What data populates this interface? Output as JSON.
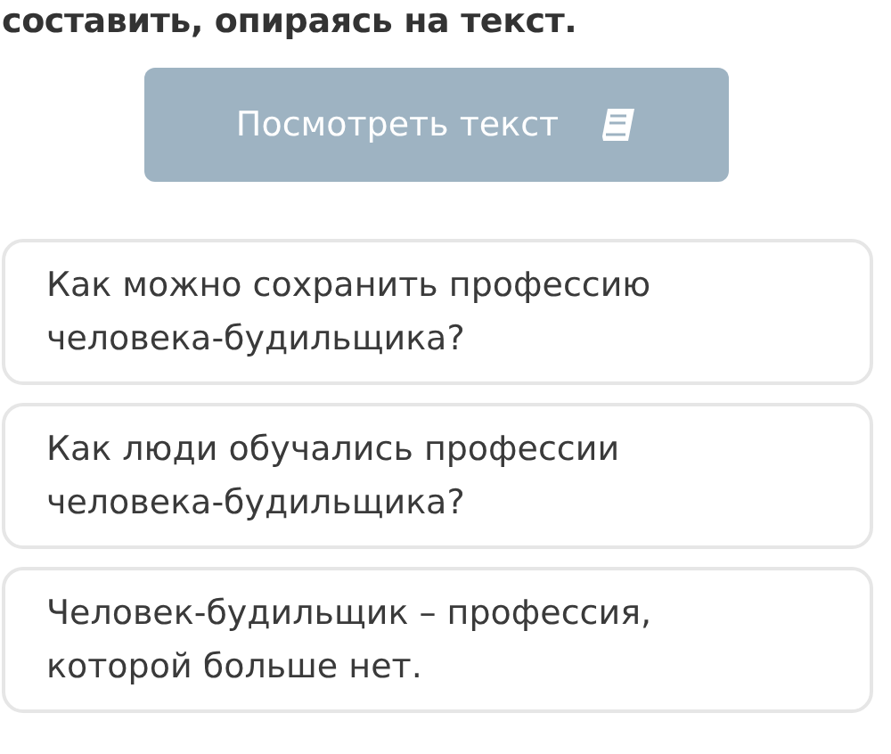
{
  "heading": "составить, опираясь на текст.",
  "view_text_button": {
    "label": "Посмотреть текст"
  },
  "options": [
    {
      "text": "Как можно сохранить профессию человека-будильщика?"
    },
    {
      "text": "Как люди обучались профессии человека-будильщика?"
    },
    {
      "text": "Человек-будильщик – профессия, которой больше нет."
    }
  ]
}
